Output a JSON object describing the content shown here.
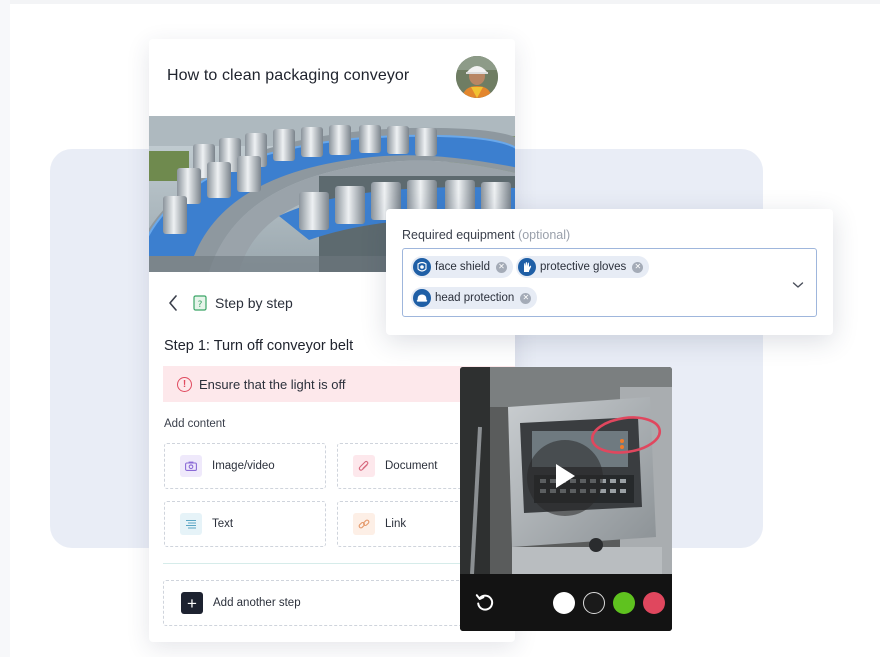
{
  "card": {
    "title": "How to clean packaging conveyor",
    "step_nav_label": "Step by step",
    "step_heading": "Step 1: Turn off conveyor belt",
    "alert_text": "Ensure that the light is off",
    "add_content_label": "Add content",
    "tiles": [
      {
        "label": "Image/video",
        "icon": "camera-icon",
        "bg": "#efe9fb",
        "fg": "#8a6ad6"
      },
      {
        "label": "Document",
        "icon": "paperclip-icon",
        "bg": "#fde8ec",
        "fg": "#d76a7f"
      },
      {
        "label": "Text",
        "icon": "text-lines-icon",
        "bg": "#e6f3f8",
        "fg": "#5aa5c4"
      },
      {
        "label": "Link",
        "icon": "link-icon",
        "bg": "#fdefe6",
        "fg": "#e59a6c"
      }
    ],
    "add_step_label": "Add another step"
  },
  "equipment": {
    "label": "Required equipment",
    "optional": "(optional)",
    "chips": [
      {
        "label": "face shield",
        "icon": "face-shield-icon"
      },
      {
        "label": "protective gloves",
        "icon": "gloves-icon"
      },
      {
        "label": "head protection",
        "icon": "helmet-icon"
      }
    ]
  },
  "video": {
    "colors": [
      "#ffffff",
      "#1a1a1a",
      "#5fc21f",
      "#e0475e"
    ]
  },
  "colors": {
    "alert_bg": "#fde8eb",
    "alert_accent": "#e04a5f",
    "chip_bg": "#e7ecf5",
    "chip_icon": "#1f5fa6",
    "panel_bg": "#e9edf6"
  }
}
